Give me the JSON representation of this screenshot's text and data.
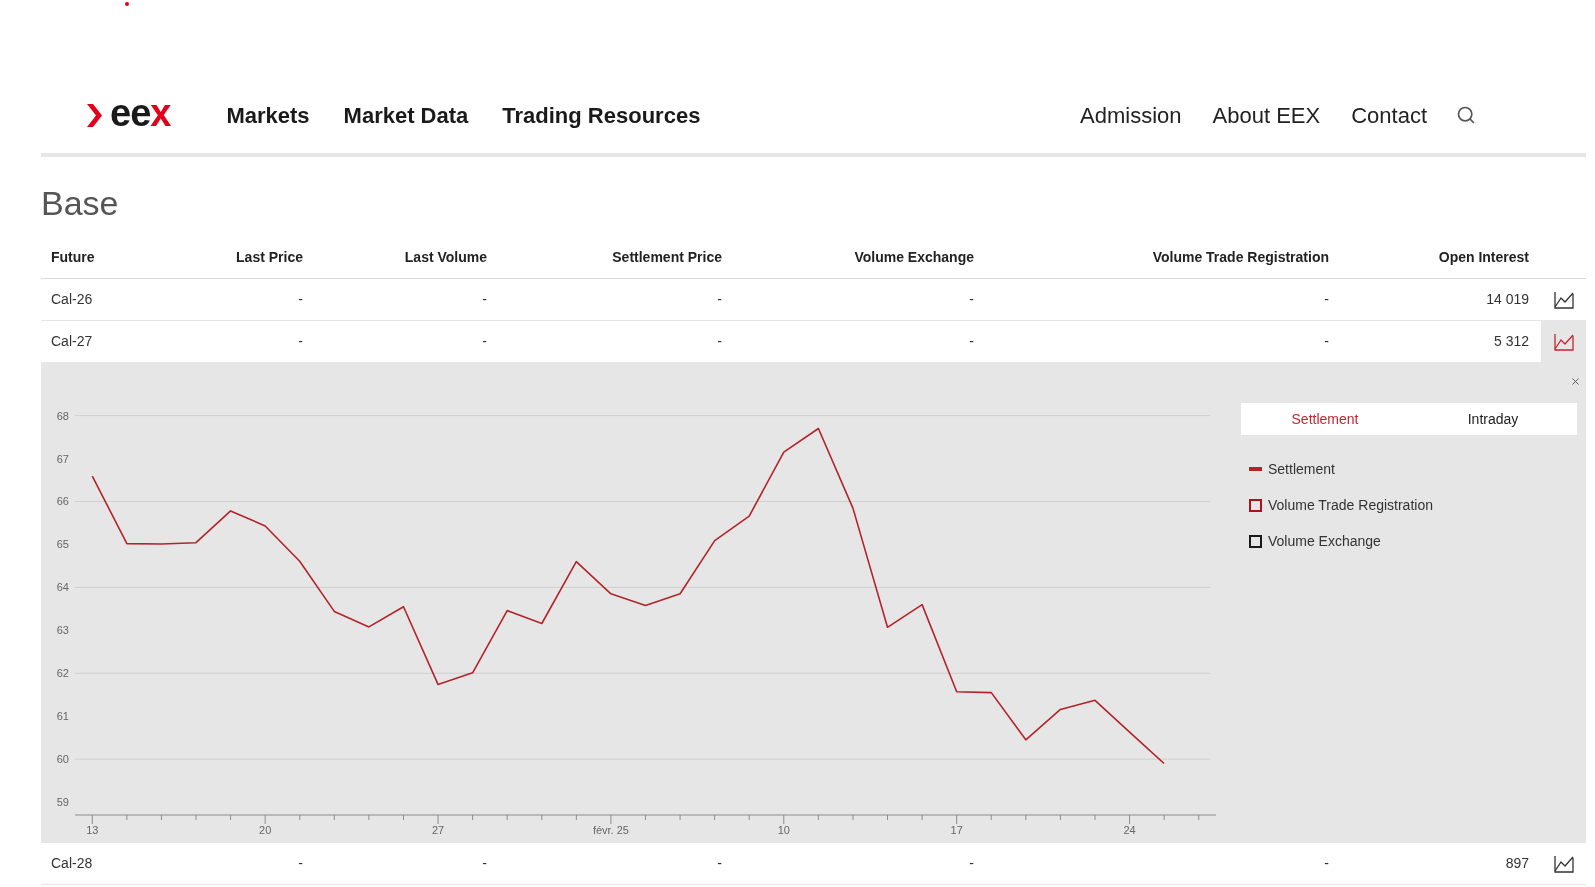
{
  "header": {
    "logo": {
      "parts": [
        {
          "text": "ee",
          "color": "#1a1a1a"
        },
        {
          "text": "x",
          "color": "#e2001a"
        }
      ]
    },
    "main_nav": [
      "Markets",
      "Market Data",
      "Trading Resources"
    ],
    "secondary_nav": [
      "Admission",
      "About EEX",
      "Contact"
    ]
  },
  "section_title": "Base",
  "table": {
    "columns": [
      "Future",
      "Last Price",
      "Last Volume",
      "Settlement Price",
      "Volume Exchange",
      "Volume Trade Registration",
      "Open Interest"
    ],
    "rows": [
      {
        "cells": [
          "Cal-26",
          "-",
          "-",
          "-",
          "-",
          "-",
          "14 019"
        ],
        "expanded": false
      },
      {
        "cells": [
          "Cal-27",
          "-",
          "-",
          "-",
          "-",
          "-",
          "5 312"
        ],
        "expanded": true,
        "detail": {
          "tabs": [
            {
              "label": "Settlement",
              "selected": true
            },
            {
              "label": "Intraday",
              "selected": false
            }
          ],
          "chart_data": {
            "type": "line",
            "categories": [
              "13",
              null,
              null,
              null,
              null,
              "20",
              null,
              null,
              null,
              null,
              "27",
              null,
              null,
              null,
              null,
              "févr. 25",
              null,
              null,
              null,
              null,
              "10",
              null,
              null,
              null,
              null,
              "17",
              null,
              null,
              null,
              null,
              "24",
              null
            ],
            "ylim": [
              58.7,
              68
            ],
            "yticks": [
              59,
              60,
              61,
              62,
              63,
              64,
              65,
              66,
              67,
              68
            ],
            "grid": true,
            "series": [
              {
                "name": "Settlement",
                "color": "#b3242a",
                "values": [
                  66.59,
                  65.02,
                  65.01,
                  65.04,
                  65.78,
                  65.43,
                  64.61,
                  63.44,
                  63.08,
                  63.55,
                  61.74,
                  62.01,
                  63.46,
                  63.16,
                  64.6,
                  63.85,
                  63.58,
                  63.85,
                  65.09,
                  65.66,
                  67.15,
                  67.7,
                  65.84,
                  63.07,
                  63.6,
                  61.57,
                  61.55,
                  60.45,
                  61.16,
                  61.37,
                  60.63,
                  59.9
                ]
              }
            ]
          },
          "legend": [
            {
              "label": "Volume Trade Registration",
              "kind": "box",
              "color": "#a3161c"
            },
            {
              "label": "Volume Exchange",
              "kind": "box",
              "color": "#1a1a1a"
            }
          ]
        }
      },
      {
        "cells": [
          "Cal-28",
          "-",
          "-",
          "-",
          "-",
          "-",
          "897"
        ],
        "expanded": false
      }
    ]
  }
}
